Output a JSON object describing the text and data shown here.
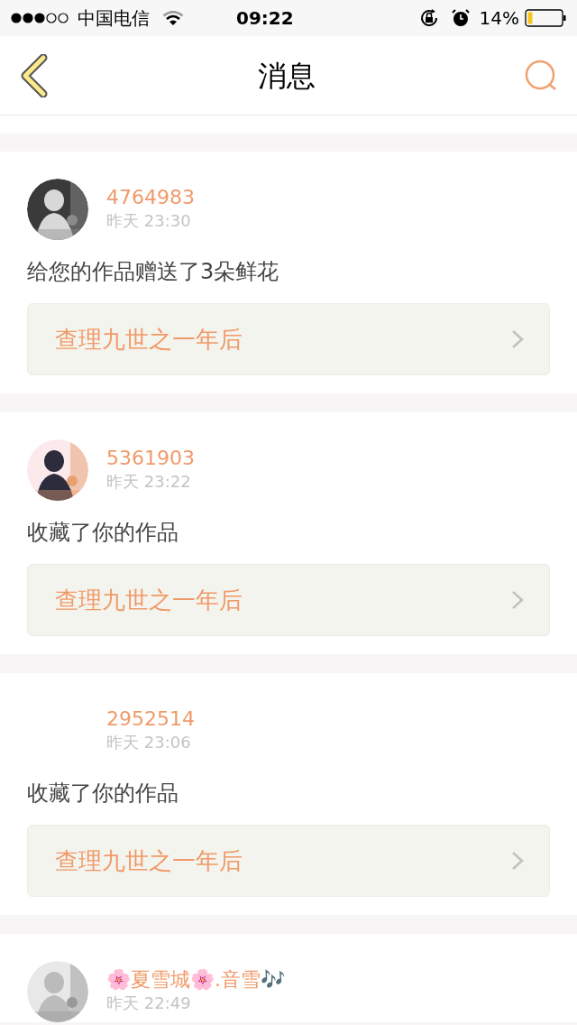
{
  "status_bar": {
    "carrier": "中国电信",
    "time": "09:22",
    "battery": "14%"
  },
  "header": {
    "title": "消息"
  },
  "messages": [
    {
      "user": "4764983",
      "time": "昨天 23:30",
      "text": "给您的作品赠送了3朵鲜花",
      "work": "查理九世之一年后"
    },
    {
      "user": "5361903",
      "time": "昨天 23:22",
      "text": "收藏了你的作品",
      "work": "查理九世之一年后"
    },
    {
      "user": "2952514",
      "time": "昨天 23:06",
      "text": "收藏了你的作品",
      "work": "查理九世之一年后"
    },
    {
      "user": "🌸夏雪城🌸.音雪🎶",
      "time": "昨天 22:49"
    }
  ]
}
